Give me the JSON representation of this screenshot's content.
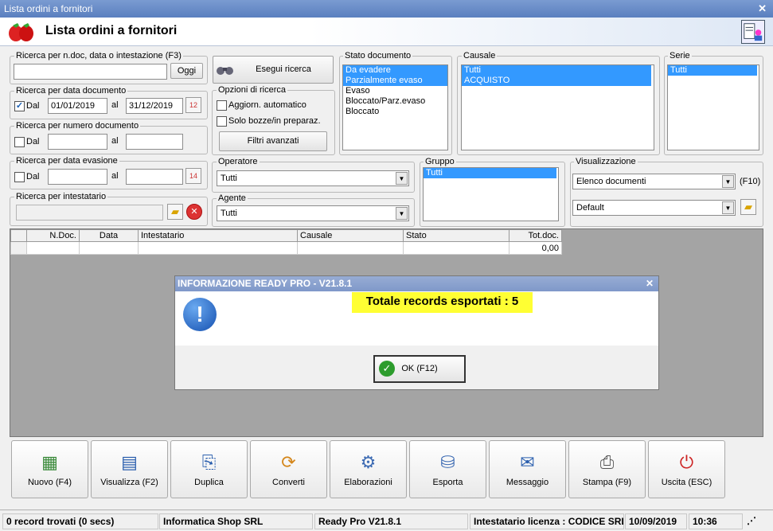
{
  "window": {
    "title": "Lista ordini a fornitori"
  },
  "header": {
    "title": "Lista ordini a fornitori"
  },
  "search_text": {
    "legend": "Ricerca per n.doc, data o intestazione (F3)",
    "value": "",
    "button": "Oggi"
  },
  "search_button": {
    "label": "Esegui ricerca"
  },
  "doc_date": {
    "legend": "Ricerca per data documento",
    "checked": true,
    "dal": "Dal",
    "al": "al",
    "from": "01/01/2019",
    "to": "31/12/2019"
  },
  "doc_number": {
    "legend": "Ricerca per numero documento",
    "dal": "Dal",
    "al": "al",
    "from": "",
    "to": ""
  },
  "evasion_date": {
    "legend": "Ricerca per data evasione",
    "dal": "Dal",
    "al": "al",
    "from": "",
    "to": ""
  },
  "holder": {
    "legend": "Ricerca per intestatario",
    "value": ""
  },
  "options": {
    "legend": "Opzioni di ricerca",
    "auto_update": "Aggiorn. automatico",
    "drafts_only": "Solo bozze/in preparaz.",
    "advanced": "Filtri avanzati"
  },
  "doc_state": {
    "legend": "Stato documento",
    "items": [
      "Da evadere",
      "Parzialmente evaso",
      "Evaso",
      "Bloccato/Parz.evaso",
      "Bloccato"
    ],
    "selected": [
      0,
      1
    ]
  },
  "causale": {
    "legend": "Causale",
    "items": [
      "Tutti",
      "ACQUISTO"
    ],
    "selected": [
      0,
      1
    ]
  },
  "serie": {
    "legend": "Serie",
    "items": [
      "Tutti"
    ],
    "selected": [
      0
    ]
  },
  "operatore": {
    "legend": "Operatore",
    "value": "Tutti"
  },
  "agente": {
    "legend": "Agente",
    "value": "Tutti"
  },
  "gruppo": {
    "legend": "Gruppo",
    "items": [
      "Tutti"
    ],
    "selected": [
      0
    ]
  },
  "visualizzazione": {
    "legend": "Visualizzazione",
    "view": "Elenco documenti",
    "hint": "(F10)",
    "layout": "Default"
  },
  "grid": {
    "columns": [
      "",
      "N.Doc.",
      "Data",
      "Intestatario",
      "Causale",
      "Stato",
      "Tot.doc."
    ],
    "total": "0,00"
  },
  "dialog": {
    "title": "INFORMAZIONE READY PRO - V21.8.1",
    "message": "Totale records esportati : 5",
    "ok": "OK (F12)"
  },
  "toolbar": [
    {
      "label": "Nuovo (F4)",
      "icon": "new-doc-icon",
      "glyph": "▦"
    },
    {
      "label": "Visualizza (F2)",
      "icon": "view-icon",
      "glyph": "▤"
    },
    {
      "label": "Duplica",
      "icon": "duplicate-icon",
      "glyph": "⎘"
    },
    {
      "label": "Converti",
      "icon": "convert-icon",
      "glyph": "⟳"
    },
    {
      "label": "Elaborazioni",
      "icon": "process-icon",
      "glyph": "⚙"
    },
    {
      "label": "Esporta",
      "icon": "export-icon",
      "glyph": "⛁"
    },
    {
      "label": "Messaggio",
      "icon": "message-icon",
      "glyph": "✉"
    },
    {
      "label": "Stampa (F9)",
      "icon": "print-icon",
      "glyph": "⎙"
    },
    {
      "label": "Uscita (ESC)",
      "icon": "exit-icon",
      "glyph": "⏻"
    }
  ],
  "status": {
    "records": "0 record trovati (0 secs)",
    "company": "Informatica Shop SRL",
    "version": "Ready Pro V21.8.1",
    "license": "Intestatario licenza : CODICE SRL",
    "date": "10/09/2019",
    "time": "10:36"
  }
}
